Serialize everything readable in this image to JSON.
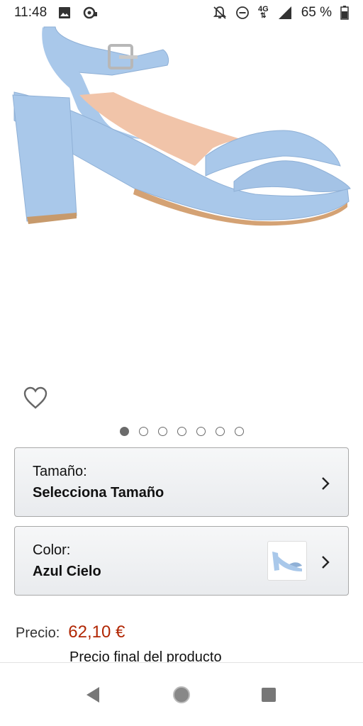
{
  "status_bar": {
    "time": "11:48",
    "network": "4G",
    "battery": "65 %",
    "icons": [
      "image-icon",
      "sync-icon",
      "notifications-off-icon",
      "do-not-disturb-icon",
      "signal-icon",
      "battery-icon"
    ]
  },
  "product": {
    "image": "light-blue-suede-sandal",
    "gallery_count": 7,
    "gallery_active_index": 0
  },
  "size_selector": {
    "label": "Tamaño:",
    "value": "Selecciona Tamaño"
  },
  "color_selector": {
    "label": "Color:",
    "value": "Azul Cielo"
  },
  "price": {
    "label": "Precio:",
    "value": "62,10 €",
    "note": "Precio final del producto"
  },
  "colors": {
    "price": "#b12704",
    "shoe": "#a9c8ea",
    "selector_border": "#a8a8a8"
  },
  "nav": {
    "icons": [
      "back-icon",
      "home-icon",
      "recent-apps-icon"
    ]
  }
}
